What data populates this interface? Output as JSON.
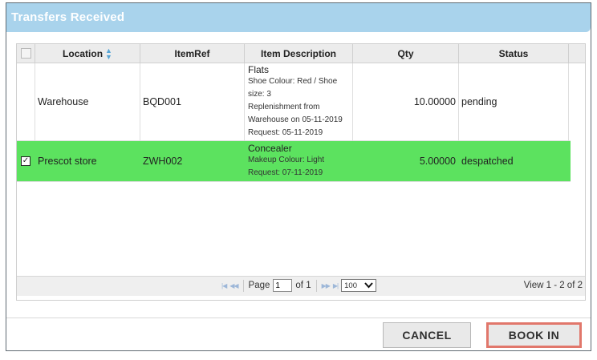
{
  "dialog": {
    "title": "Transfers Received"
  },
  "grid": {
    "columns": [
      "Location",
      "ItemRef",
      "Item Description",
      "Qty",
      "Status"
    ],
    "rows": [
      {
        "location": "Warehouse",
        "itemref": "BQD001",
        "desc_main": "Flats",
        "desc_lines": [
          "Shoe Colour: Red / Shoe",
          "size: 3",
          "Replenishment from",
          "Warehouse on 05-11-2019",
          "Request: 05-11-2019"
        ],
        "qty": "10.00000",
        "status": "pending",
        "checked": false
      },
      {
        "location": "Prescot store",
        "itemref": "ZWH002",
        "desc_main": "Concealer",
        "desc_lines": [
          "Makeup Colour: Light",
          "Request: 07-11-2019"
        ],
        "qty": "5.00000",
        "status": "despatched",
        "checked": true
      }
    ]
  },
  "pager": {
    "page_label": "Page",
    "page_value": "1",
    "of_label": "of 1",
    "page_size": "100",
    "view_text": "View 1 - 2 of 2"
  },
  "buttons": {
    "cancel": "CANCEL",
    "book_in": "BOOK IN"
  },
  "colors": {
    "title_bar": "#a9d3ec",
    "selected_row": "#5ce25f",
    "book_in_highlight": "#e1776b"
  },
  "icons": {
    "sort": "sort-icon",
    "first_page": "first-page-icon",
    "prev_page": "prev-page-icon",
    "next_page": "next-page-icon",
    "last_page": "last-page-icon",
    "dropdown": "chevron-down-icon"
  }
}
